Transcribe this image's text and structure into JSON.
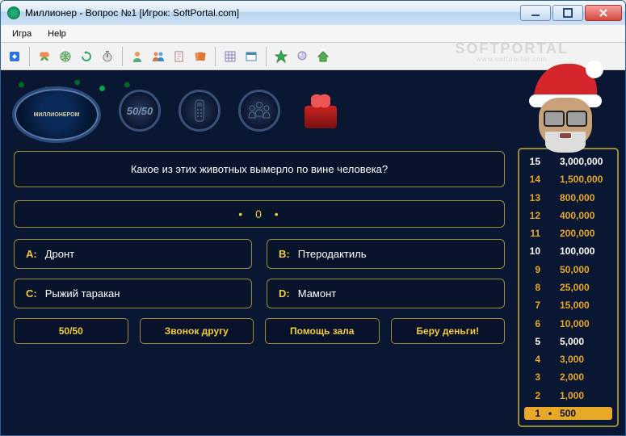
{
  "window": {
    "title": "Миллионер - Вопрос №1 [Игрок: SoftPortal.com]"
  },
  "menu": {
    "game": "Игра",
    "help": "Help"
  },
  "watermark": {
    "main": "SOFTPORTAL",
    "sub": "www.softportal.com"
  },
  "logo_text": "МИЛЛИОНЕРОМ",
  "question": "Какое из этих животных вымерло по вине человека?",
  "score_display": "0",
  "answers": {
    "a": {
      "letter": "A:",
      "text": "Дронт"
    },
    "b": {
      "letter": "B:",
      "text": "Птеродактиль"
    },
    "c": {
      "letter": "C:",
      "text": "Рыжий таракан"
    },
    "d": {
      "letter": "D:",
      "text": "Мамонт"
    }
  },
  "lifelines": {
    "fifty_fifty_icon": "50/50"
  },
  "actions": {
    "fifty": "50/50",
    "phone": "Звонок другу",
    "audience": "Помощь зала",
    "walk": "Беру деньги!"
  },
  "ladder": [
    {
      "n": "15",
      "amt": "3,000,000",
      "cls": "milestone"
    },
    {
      "n": "14",
      "amt": "1,500,000",
      "cls": "normal"
    },
    {
      "n": "13",
      "amt": "800,000",
      "cls": "normal"
    },
    {
      "n": "12",
      "amt": "400,000",
      "cls": "normal"
    },
    {
      "n": "11",
      "amt": "200,000",
      "cls": "normal"
    },
    {
      "n": "10",
      "amt": "100,000",
      "cls": "milestone"
    },
    {
      "n": "9",
      "amt": "50,000",
      "cls": "normal"
    },
    {
      "n": "8",
      "amt": "25,000",
      "cls": "normal"
    },
    {
      "n": "7",
      "amt": "15,000",
      "cls": "normal"
    },
    {
      "n": "6",
      "amt": "10,000",
      "cls": "normal"
    },
    {
      "n": "5",
      "amt": "5,000",
      "cls": "milestone"
    },
    {
      "n": "4",
      "amt": "3,000",
      "cls": "normal"
    },
    {
      "n": "3",
      "amt": "2,000",
      "cls": "normal"
    },
    {
      "n": "2",
      "amt": "1,000",
      "cls": "normal"
    },
    {
      "n": "1",
      "amt": "500",
      "cls": "current"
    }
  ]
}
